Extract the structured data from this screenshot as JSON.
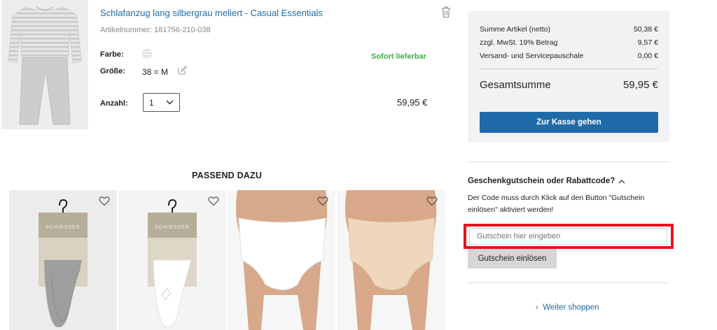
{
  "product": {
    "title": "Schlafanzug lang silbergrau meliert - Casual Essentials",
    "article_number": "Artikelnummer: 181756-210-038",
    "color_label": "Farbe:",
    "size_label": "Größe:",
    "size_value": "38 = M",
    "quantity_label": "Anzahl:",
    "quantity_value": "1",
    "availability": "Sofort lieferbar",
    "price": "59,95 €"
  },
  "summary": {
    "rows": [
      {
        "label": "Summe Artikel (netto)",
        "value": "50,38 €"
      },
      {
        "label": "zzgl. MwSt. 19% Betrag",
        "value": "9,57 €"
      },
      {
        "label": "Versand- und Servicepauschale",
        "value": "0,00 €"
      }
    ],
    "total_label": "Gesamtsumme",
    "total_value": "59,95 €",
    "checkout_label": "Zur Kasse gehen"
  },
  "voucher": {
    "title": "Geschenkgutschein oder Rabattcode?",
    "description": "Der Code muss durch Klick auf den Button \"Gutschein einlösen\" aktiviert werden!",
    "placeholder": "Gutschein hier eingeben",
    "button_label": "Gutschein einlösen"
  },
  "continue_shopping": "Weiter shoppen",
  "recommendations": {
    "title": "PASSEND DAZU",
    "items": [
      {
        "brand": "SCHIESSER",
        "kind": "socks-grey"
      },
      {
        "brand": "SCHIESSER",
        "kind": "socks-white"
      },
      {
        "kind": "brief-white"
      },
      {
        "kind": "brief-beige"
      }
    ]
  },
  "colors": {
    "link_blue": "#1f6ba6",
    "button_blue": "#1f6aa8",
    "available_green": "#3cb04a",
    "highlight_red": "#e3141f"
  }
}
